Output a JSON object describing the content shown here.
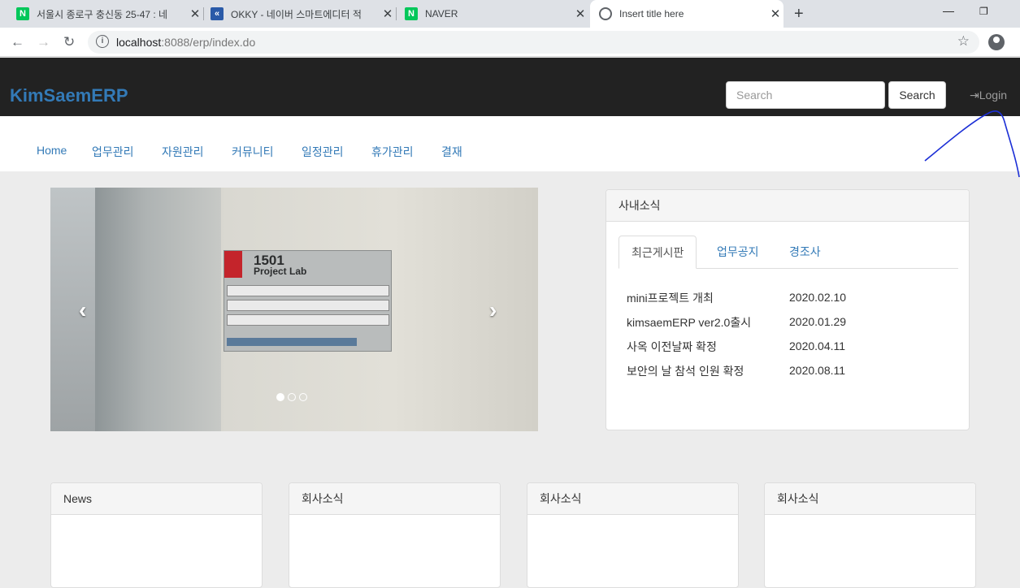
{
  "browser": {
    "tabs": [
      {
        "title": "서울시 종로구 충신동 25-47 : 네",
        "favicon_color": "#03c75a",
        "favicon_letter": "N"
      },
      {
        "title": "OKKY - 네이버 스마트에디터 적",
        "favicon_color": "#2a5aa8",
        "favicon_letter": "«"
      },
      {
        "title": "NAVER",
        "favicon_color": "#03c75a",
        "favicon_letter": "N"
      },
      {
        "title": "Insert title here",
        "favicon_color": "#5f6368",
        "favicon_letter": ""
      }
    ],
    "url_host": "localhost",
    "url_rest": ":8088/erp/index.do"
  },
  "navbar": {
    "brand": "KimSaemERP",
    "search_placeholder": "Search",
    "search_button": "Search",
    "login": "Login"
  },
  "menu": [
    "Home",
    "업무관리",
    "자원관리",
    "커뮤니티",
    "일정관리",
    "휴가관리",
    "결재"
  ],
  "carousel": {
    "slide_count": 3,
    "active_slide": 1,
    "sign_number": "1501",
    "sign_title": "Project Lab"
  },
  "news_panel": {
    "title": "사내소식",
    "tabs": [
      "최근게시판",
      "업무공지",
      "경조사"
    ],
    "active_tab": 0,
    "items": [
      {
        "title": "mini프로젝트 개최",
        "date": "2020.02.10"
      },
      {
        "title": "kimsaemERP ver2.0출시",
        "date": "2020.01.29"
      },
      {
        "title": "사옥 이전날짜 확정",
        "date": "2020.04.11"
      },
      {
        "title": "보안의 날 참석 인원 확정",
        "date": "2020.08.11"
      }
    ]
  },
  "bottom_panels": [
    "News",
    "회사소식",
    "회사소식",
    "회사소식"
  ],
  "colors": {
    "brand": "#337ab7",
    "navbar": "#222222",
    "link": "#337ab7"
  }
}
